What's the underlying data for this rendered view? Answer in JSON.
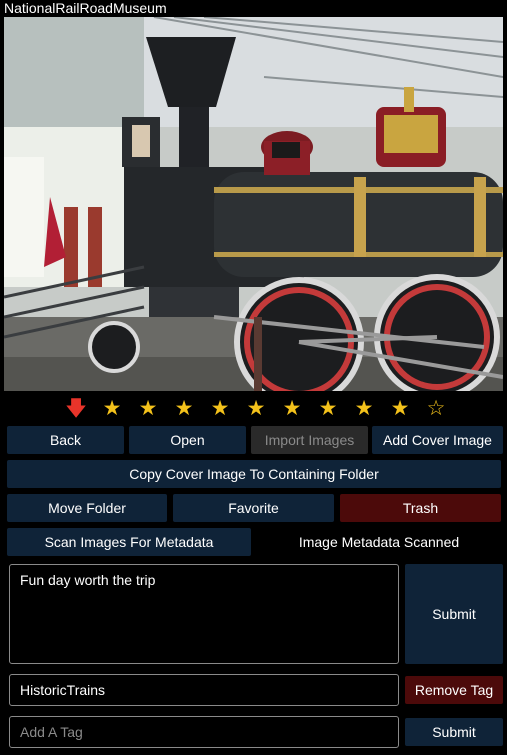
{
  "window": {
    "title": "NationalRailRoadMuseum"
  },
  "image": {
    "alt": ""
  },
  "rating": {
    "down_icon": "down-arrow-icon",
    "filled_stars": 9,
    "total_stars": 10,
    "star_color": "#f4c21b",
    "down_color": "#e8342a"
  },
  "buttons": {
    "back": "Back",
    "open": "Open",
    "import_images": "Import Images",
    "add_cover_image": "Add Cover Image",
    "copy_cover": "Copy Cover Image To Containing Folder",
    "move_folder": "Move Folder",
    "favorite": "Favorite",
    "trash": "Trash",
    "scan_metadata": "Scan Images For Metadata",
    "submit_note": "Submit",
    "remove_tag": "Remove Tag",
    "submit_tag": "Submit"
  },
  "status": {
    "metadata_scanned": "Image Metadata Scanned"
  },
  "note": {
    "value": "Fun day worth the trip"
  },
  "tag": {
    "current": "HistoricTrains"
  },
  "new_tag": {
    "placeholder": "Add A Tag",
    "value": ""
  },
  "colors": {
    "button_bg": "#0f2338",
    "danger_bg": "#4c0a0a",
    "disabled_bg": "#2a2a2a"
  }
}
